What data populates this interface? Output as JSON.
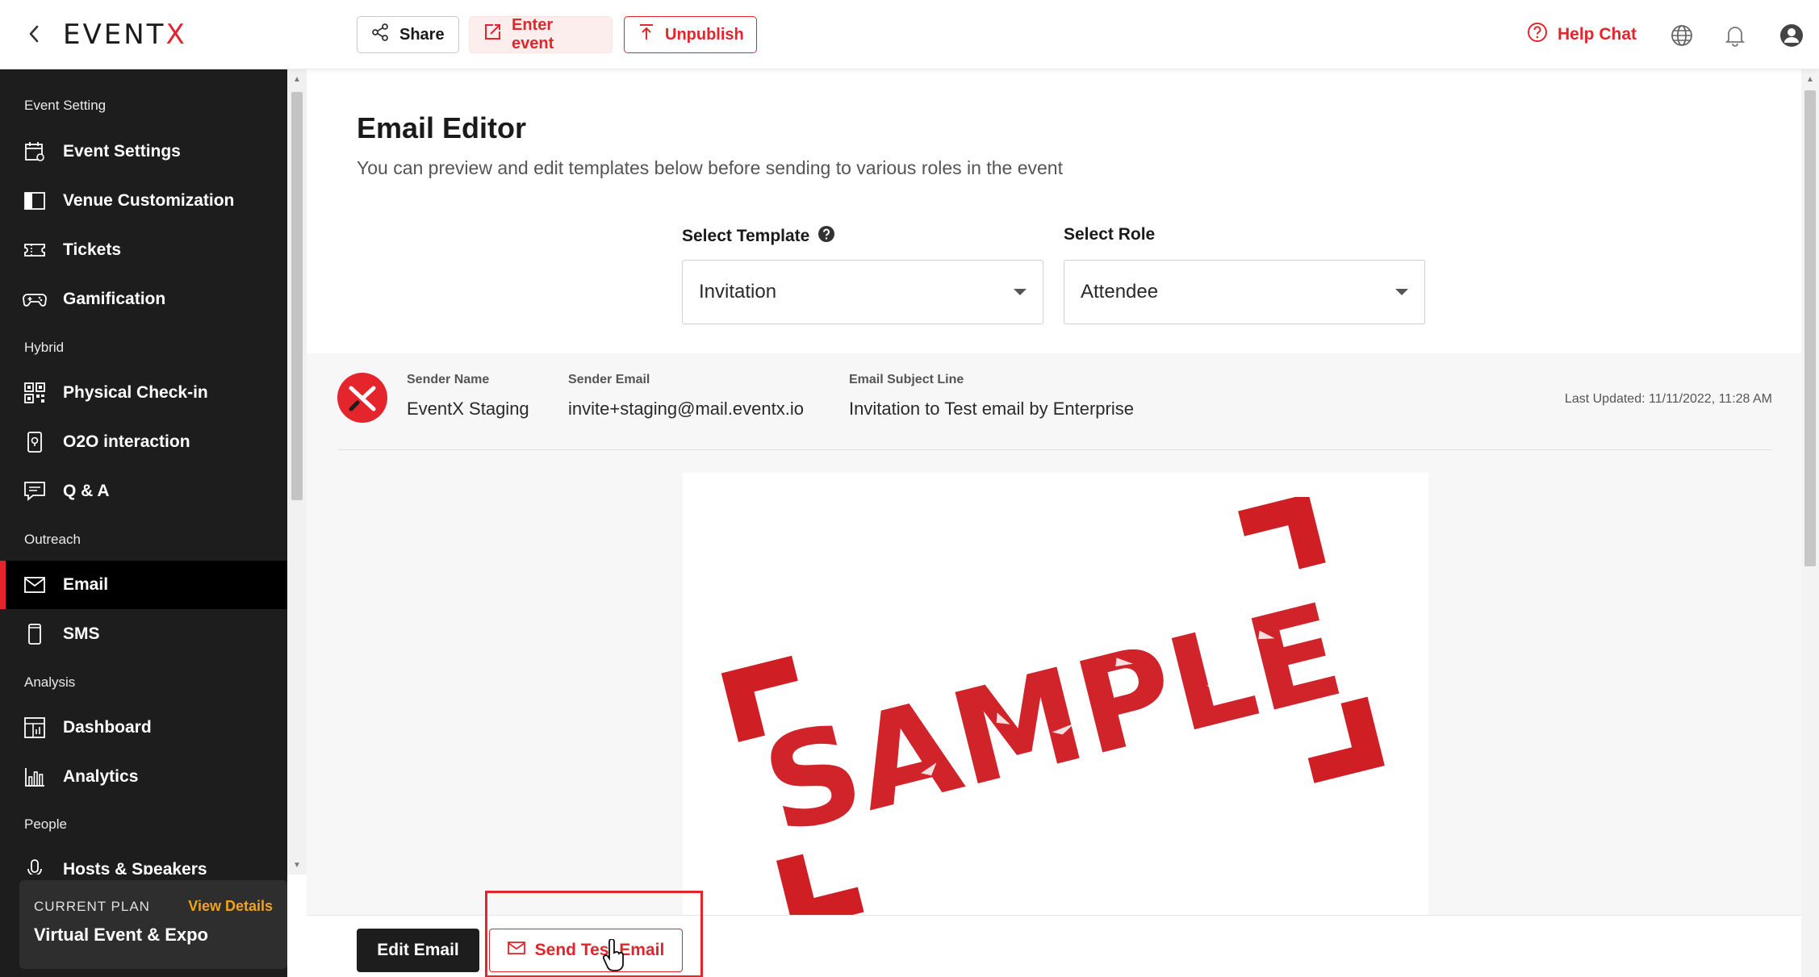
{
  "topbar": {
    "logo_left": "EVENT",
    "logo_right": "X",
    "share_label": "Share",
    "enter_event_label": "Enter event",
    "unpublish_label": "Unpublish",
    "help_chat_label": "Help Chat"
  },
  "sidebar": {
    "sections": {
      "event_setting": "Event Setting",
      "hybrid": "Hybrid",
      "outreach": "Outreach",
      "analysis": "Analysis",
      "people": "People"
    },
    "items": {
      "event_settings": "Event Settings",
      "venue_customization": "Venue Customization",
      "tickets": "Tickets",
      "gamification": "Gamification",
      "physical_checkin": "Physical Check-in",
      "o2o": "O2O interaction",
      "qa": "Q & A",
      "email": "Email",
      "sms": "SMS",
      "dashboard": "Dashboard",
      "analytics": "Analytics",
      "hosts": "Hosts & Speakers"
    },
    "active_item": "Email",
    "plan": {
      "kicker": "CURRENT PLAN",
      "link": "View Details",
      "name": "Virtual Event & Expo"
    }
  },
  "main": {
    "title": "Email Editor",
    "subtitle": "You can preview and edit templates below before sending to various roles in the event",
    "template_label": "Select Template",
    "template_value": "Invitation",
    "role_label": "Select Role",
    "role_value": "Attendee",
    "sender": {
      "name_key": "Sender Name",
      "name_value": "EventX Staging",
      "email_key": "Sender Email",
      "email_value": "invite+staging@mail.eventx.io",
      "subject_key": "Email Subject Line",
      "subject_value": "Invitation to Test email by Enterprise",
      "last_updated": "Last Updated: 11/11/2022, 11:28 AM"
    },
    "preview_stamp_text": "SAMPLE",
    "edit_button": "Edit Email",
    "send_test_button": "Send Test Email"
  },
  "colors": {
    "accent": "#e4252b",
    "sidebar_bg": "#1d1d1d",
    "plan_link": "#f0a321"
  }
}
